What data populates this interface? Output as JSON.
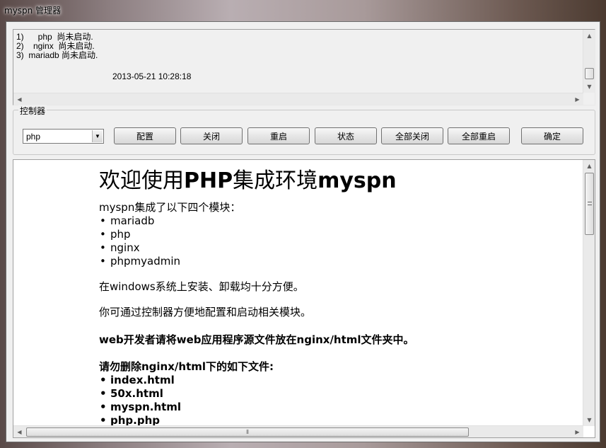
{
  "window": {
    "title": "myspn 管理器"
  },
  "log": {
    "lines": [
      "1)      php  尚未启动.",
      "2)    nginx  尚未启动.",
      "3)  mariadb 尚未启动."
    ],
    "timestamp": "2013-05-21 10:28:18"
  },
  "controller": {
    "label": "控制器",
    "module_select": {
      "value": "php"
    },
    "buttons": [
      "配置",
      "关闭",
      "重启",
      "状态",
      "全部关闭",
      "全部重启",
      "确定"
    ]
  },
  "welcome": {
    "title_prefix": "欢迎使用",
    "title_bold1": "PHP",
    "title_mid": "集成环境",
    "title_bold2": "myspn",
    "intro": "myspn集成了以下四个模块：",
    "modules": [
      "mariadb",
      "php",
      "nginx",
      "phpmyadmin"
    ],
    "install_note": "在windows系统上安装、卸载均十分方便。",
    "control_note": "你可通过控制器方便地配置和启动相关模块。",
    "web_note": "web开发者请将web应用程序源文件放在nginx/html文件夹中。",
    "delete_note": "请勿删除nginx/html下的如下文件:",
    "protected_files": [
      "index.html",
      "50x.html",
      "myspn.html",
      "php.php"
    ]
  }
}
